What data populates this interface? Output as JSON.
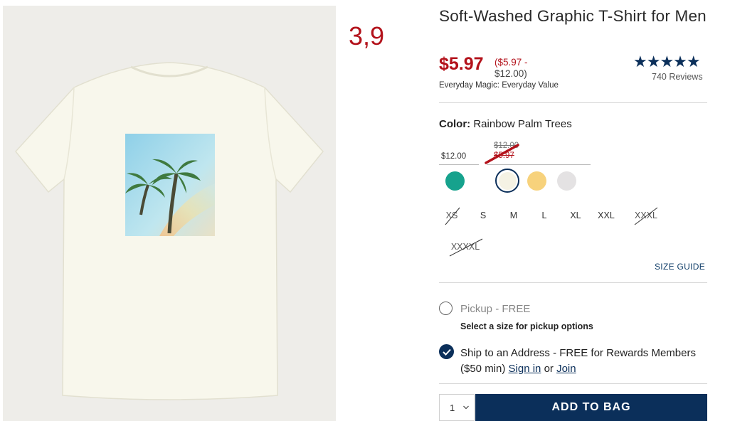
{
  "overlay": {
    "number": "3,9"
  },
  "product": {
    "title": "Soft-Washed Graphic T-Shirt for Men",
    "price_now": "$5.97",
    "price_range_low": "($5.97 -",
    "price_range_high": "$12.00)",
    "tagline": "Everyday Magic: Everyday Value",
    "stars": "★★★★★",
    "reviews": "740 Reviews"
  },
  "color": {
    "label": "Color:",
    "selected": "Rainbow Palm Trees",
    "price_group_a": "$12.00",
    "price_group_b_old": "$12.00",
    "price_group_b_new": "$5.97",
    "swatches": [
      {
        "name": "teal",
        "color": "#16a28d"
      },
      {
        "name": "cream",
        "color": "#f5f2e4"
      },
      {
        "name": "yellow",
        "color": "#f7d27c"
      },
      {
        "name": "light-gray",
        "color": "#e4e2e3"
      }
    ]
  },
  "sizes": [
    {
      "label": "XS",
      "available": false
    },
    {
      "label": "S",
      "available": true
    },
    {
      "label": "M",
      "available": true
    },
    {
      "label": "L",
      "available": true
    },
    {
      "label": "XL",
      "available": true
    },
    {
      "label": "XXL",
      "available": true
    },
    {
      "label": "XXXL",
      "available": false
    },
    {
      "label": "XXXXL",
      "available": false
    }
  ],
  "size_guide": "SIZE GUIDE",
  "fulfillment": {
    "pickup_label": "Pickup - FREE",
    "pickup_note": "Select a size for pickup options",
    "ship_label_part1": "Ship to an Address - FREE for Rewards Members ($50 min) ",
    "sign_in": "Sign in",
    "or": " or ",
    "join": "Join"
  },
  "purchase": {
    "quantity": "1",
    "add_to_bag": "ADD TO BAG"
  },
  "colors": {
    "brand_navy": "#0b2f5a",
    "sale_red": "#b3121b"
  }
}
